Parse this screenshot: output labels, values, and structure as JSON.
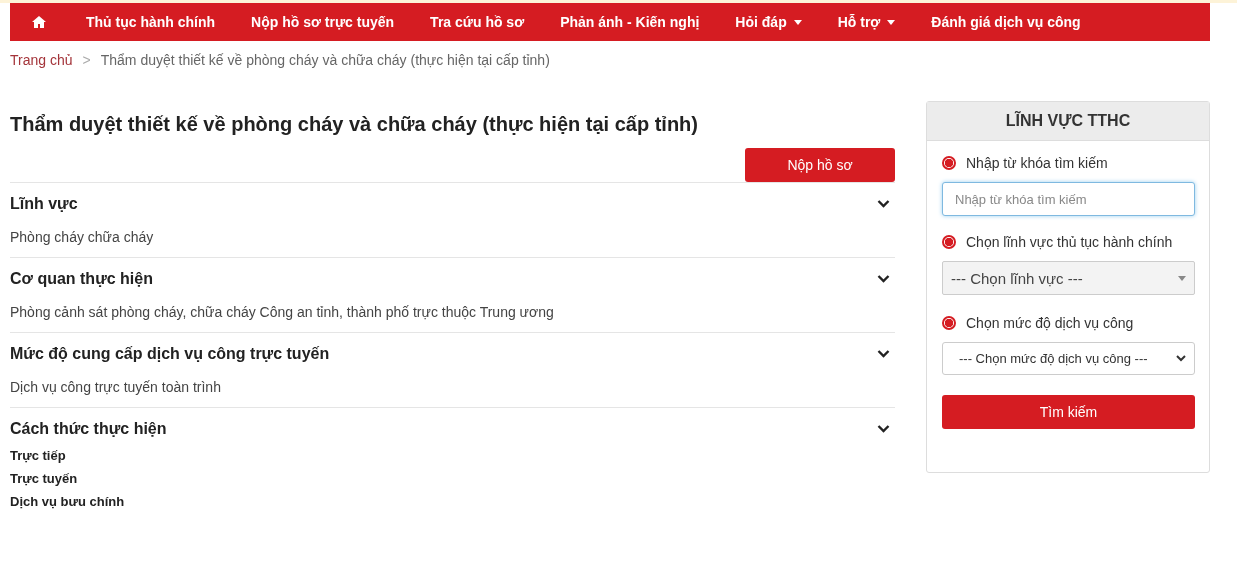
{
  "nav": [
    {
      "label": "Thủ tục hành chính",
      "dropdown": false
    },
    {
      "label": "Nộp hồ sơ trực tuyến",
      "dropdown": false
    },
    {
      "label": "Tra cứu hồ sơ",
      "dropdown": false
    },
    {
      "label": "Phản ánh - Kiến nghị",
      "dropdown": false
    },
    {
      "label": "Hỏi đáp",
      "dropdown": true
    },
    {
      "label": "Hỗ trợ",
      "dropdown": true
    },
    {
      "label": "Đánh giá dịch vụ công",
      "dropdown": false
    }
  ],
  "breadcrumb": {
    "home": "Trang chủ",
    "separator": ">",
    "current": "Thẩm duyệt thiết kế về phòng cháy và chữa cháy (thực hiện tại cấp tỉnh)"
  },
  "title": "Thẩm duyệt thiết kế về phòng cháy và chữa cháy (thực hiện tại cấp tỉnh)",
  "submit_button": "Nộp hồ sơ",
  "sections": [
    {
      "heading": "Lĩnh vực",
      "kind": "text",
      "lines": [
        "Phòng cháy chữa cháy"
      ]
    },
    {
      "heading": "Cơ quan thực hiện",
      "kind": "text",
      "lines": [
        "Phòng cảnh sát phòng cháy, chữa cháy Công an tỉnh, thành phố trực thuộc Trung ương"
      ]
    },
    {
      "heading": "Mức độ cung cấp dịch vụ công trực tuyến",
      "kind": "text",
      "lines": [
        "Dịch vụ công trực tuyến toàn trình"
      ]
    },
    {
      "heading": "Cách thức thực hiện",
      "kind": "list",
      "lines": [
        "Trực tiếp",
        "Trực tuyến",
        "Dịch vụ bưu chính"
      ]
    }
  ],
  "sidebar": {
    "title": "LĨNH VỰC TTHC",
    "filters": [
      {
        "label": "Nhập từ khóa tìm kiếm",
        "checked": true,
        "kind": "input",
        "placeholder": "Nhập từ khóa tìm kiếm"
      },
      {
        "label": "Chọn lĩnh vực thủ tục hành chính",
        "checked": true,
        "kind": "combo",
        "value": "--- Chọn lĩnh vực ---"
      },
      {
        "label": "Chọn mức độ dịch vụ công",
        "checked": true,
        "kind": "select",
        "value": "--- Chọn mức độ dịch vụ công ---"
      }
    ],
    "button": "Tìm kiếm"
  }
}
